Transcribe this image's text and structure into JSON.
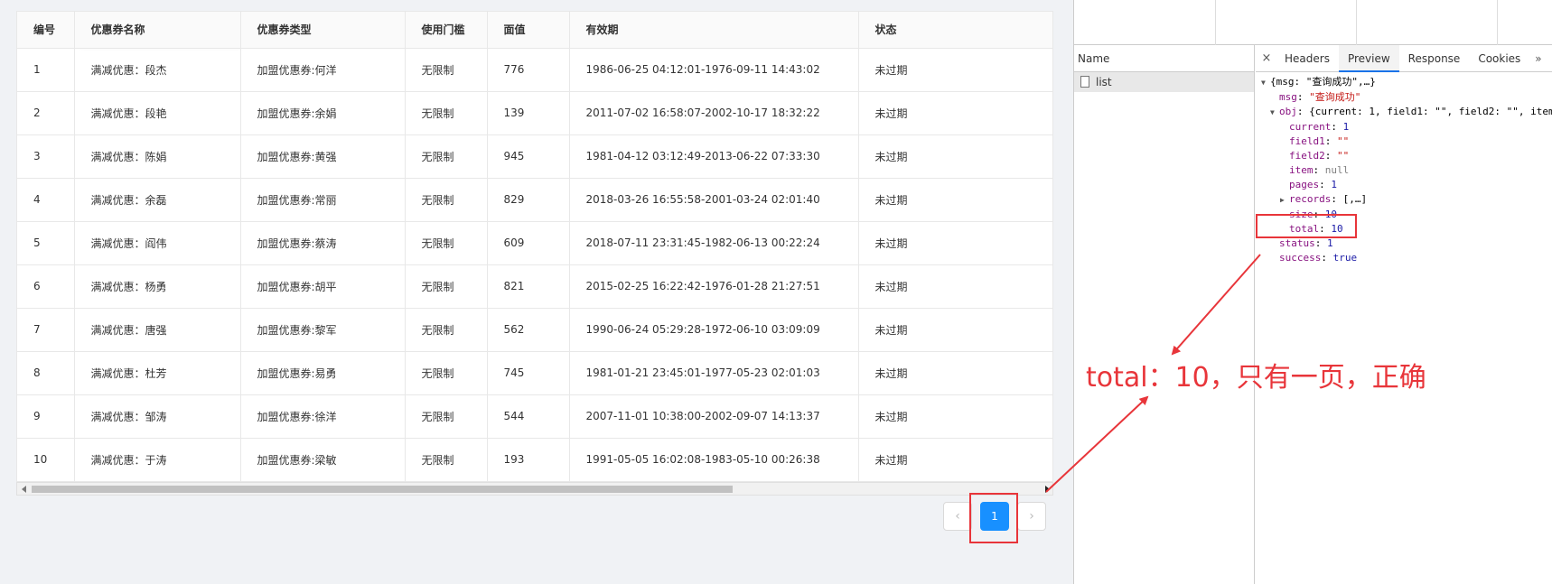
{
  "table": {
    "headers": [
      "编号",
      "优惠券名称",
      "优惠券类型",
      "使用门槛",
      "面值",
      "有效期",
      "状态"
    ],
    "rows": [
      [
        "1",
        "满减优惠：段杰",
        "加盟优惠券:何洋",
        "无限制",
        "776",
        "1986-06-25 04:12:01-1976-09-11 14:43:02",
        "未过期"
      ],
      [
        "2",
        "满减优惠：段艳",
        "加盟优惠券:余娟",
        "无限制",
        "139",
        "2011-07-02 16:58:07-2002-10-17 18:32:22",
        "未过期"
      ],
      [
        "3",
        "满减优惠：陈娟",
        "加盟优惠券:黄强",
        "无限制",
        "945",
        "1981-04-12 03:12:49-2013-06-22 07:33:30",
        "未过期"
      ],
      [
        "4",
        "满减优惠：余磊",
        "加盟优惠券:常丽",
        "无限制",
        "829",
        "2018-03-26 16:55:58-2001-03-24 02:01:40",
        "未过期"
      ],
      [
        "5",
        "满减优惠：阎伟",
        "加盟优惠券:蔡涛",
        "无限制",
        "609",
        "2018-07-11 23:31:45-1982-06-13 00:22:24",
        "未过期"
      ],
      [
        "6",
        "满减优惠：杨勇",
        "加盟优惠券:胡平",
        "无限制",
        "821",
        "2015-02-25 16:22:42-1976-01-28 21:27:51",
        "未过期"
      ],
      [
        "7",
        "满减优惠：唐强",
        "加盟优惠券:黎军",
        "无限制",
        "562",
        "1990-06-24 05:29:28-1972-06-10 03:09:09",
        "未过期"
      ],
      [
        "8",
        "满减优惠：杜芳",
        "加盟优惠券:易勇",
        "无限制",
        "745",
        "1981-01-21 23:45:01-1977-05-23 02:01:03",
        "未过期"
      ],
      [
        "9",
        "满减优惠：邹涛",
        "加盟优惠券:徐洋",
        "无限制",
        "544",
        "2007-11-01 10:38:00-2002-09-07 14:13:37",
        "未过期"
      ],
      [
        "10",
        "满减优惠：于涛",
        "加盟优惠券:梁敏",
        "无限制",
        "193",
        "1991-05-05 16:02:08-1983-05-10 00:26:38",
        "未过期"
      ]
    ]
  },
  "pagination": {
    "prev": "‹",
    "current": "1",
    "next": "›"
  },
  "devtools": {
    "name_header": "Name",
    "request_name": "list",
    "close": "×",
    "tabs": [
      "Headers",
      "Preview",
      "Response",
      "Cookies"
    ],
    "active_tab": "Preview",
    "more": "»",
    "json": {
      "root": "{msg: \"查询成功\",…}",
      "msg_key": "msg",
      "msg_val": "\"查询成功\"",
      "obj_key": "obj",
      "obj_preview": "{current: 1, field1: \"\", field2: \"\", item",
      "current_key": "current",
      "current_val": "1",
      "field1_key": "field1",
      "field1_val": "\"\"",
      "field2_key": "field2",
      "field2_val": "\"\"",
      "item_key": "item",
      "item_val": "null",
      "pages_key": "pages",
      "pages_val": "1",
      "records_key": "records",
      "records_val": "[,…]",
      "size_key": "size",
      "size_val": "10",
      "total_key": "total",
      "total_val": "10",
      "status_key": "status",
      "status_val": "1",
      "success_key": "success",
      "success_val": "true"
    }
  },
  "annotation": "total：10，只有一页，正确",
  "colors": {
    "annotation": "#e8353a",
    "primary": "#1890ff"
  }
}
